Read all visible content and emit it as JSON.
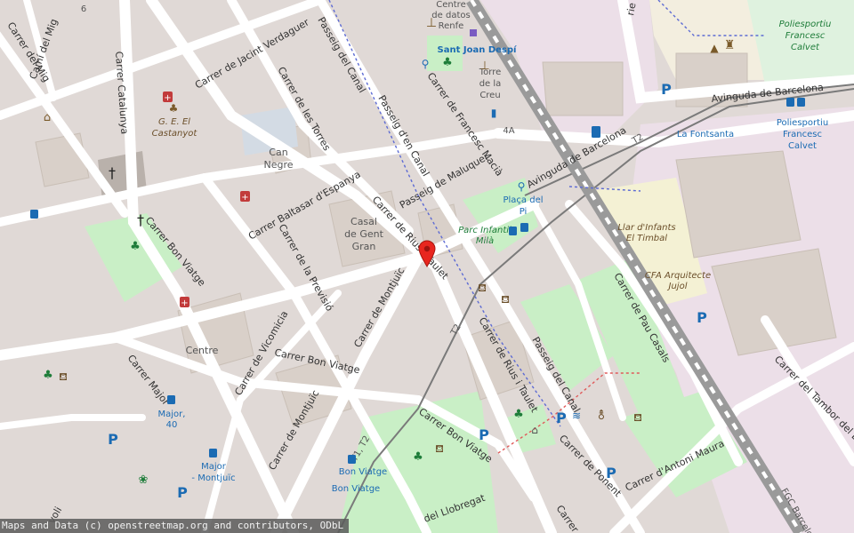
{
  "attribution": "Maps and Data (c) openstreetmap.org and contributors, ODbL",
  "streets": {
    "carrer_del_mig": "Carrer del Mig",
    "cami_del_mig": "Camí del Mig",
    "carrer_catalunya": "Carrer Catalunya",
    "jacint_verdaguer": "Carrer de Jacint Verdaguer",
    "passeig_del_canal_top": "Passeig del Canal",
    "les_torres": "Carrer de les Torres",
    "passeig_den_canal": "Passeig d'en Canal",
    "francesc_macia": "Carrer de Francesc Macià",
    "passeig_de_maluquer": "Passeig de Maluquer",
    "baltasar_despanya": "Carrer Baltasar d'Espanya",
    "rius_i_taulet_top": "Carrer de Rius i Taulet",
    "rius_i_taulet_bottom": "Carrer de Rius i Taulet",
    "bon_viatge_left": "Carrer Bon Viatge",
    "bon_viatge_mid": "Carrer Bon Viatge",
    "bon_viatge_low": "Carrer Bon Viatge",
    "la_previsio": "Carrer de la Previsió",
    "montjuic_upper": "Carrer de Montjuïc",
    "montjuic_lower": "Carrer de Montjuïc",
    "vicomicia": "Carrer de Vicomicia",
    "carrer_major": "Carrer Major",
    "avinguda_barcelona_top": "Avinguda de Barcelona",
    "avinguda_barcelona_mid": "Avinguda de Barcelona",
    "passeig_del_canal_low": "Passeig del Canal",
    "pau_casals": "Carrer de Pau Casals",
    "carrer_de_ponent": "Carrer de Ponent",
    "antoni_maura": "Carrer d'Antoni Maura",
    "tambor_del_bruc": "Carrer del Tambor del Bruc",
    "carrer_rie": "rie",
    "llobregat": "del Llobregat",
    "carrer_de_lo": "Carrer de",
    "voli": "voli"
  },
  "places": {
    "centre_datos_1": "Centre",
    "centre_datos_2": "de datos",
    "centre_datos_3": "Renfe",
    "sant_joan_despi": "Sant Joan Despí",
    "torre_1": "Torre",
    "torre_2": "de la",
    "torre_3": "Creu",
    "can_negre_1": "Can",
    "can_negre_2": "Negre",
    "casal_1": "Casal",
    "casal_2": "de Gent",
    "casal_3": "Gran",
    "centre": "Centre",
    "gee_1": "G. E. El",
    "gee_2": "Castanyot",
    "placa_del_pi_1": "Plaça del",
    "placa_del_pi_2": "Pi",
    "parc_infantil_1": "Parc Infantil",
    "parc_infantil_2": "Milà",
    "llar_1": "Llar d'Infants",
    "llar_2": "El Timbal",
    "cfa_1": "CFA Arquitecte",
    "cfa_2": "Jujol",
    "poliesportiu_1": "Poliesportiu",
    "poliesportiu_2": "Francesc",
    "poliesportiu_3": "Calvet",
    "poliesportiu_b1": "Poliesportiu",
    "poliesportiu_b2": "Francesc",
    "poliesportiu_b3": "Calvet",
    "la_fontsanta": "La Fontsanta",
    "major_40_1": "Major,",
    "major_40_2": "40",
    "major_montjuic_1": "Major",
    "major_montjuic_2": "- Montjuïc",
    "bon_viatge_stop_1": "Bon Viatge",
    "bon_viatge_stop_2": "Bon Viatge",
    "num_4a": "4A",
    "num_6": "6",
    "tram_t2_a": "T2",
    "tram_t2_b": "T2",
    "tram_t1t2": "T1, T2",
    "fgc": "FGC Barcelo"
  },
  "marker": {
    "label": "selected-location"
  },
  "colors": {
    "residential": "#e0d9d6",
    "park": "#c9efc6",
    "railway": "#9a9a9a",
    "road": "#ffffff",
    "marker": "#e8261f"
  }
}
